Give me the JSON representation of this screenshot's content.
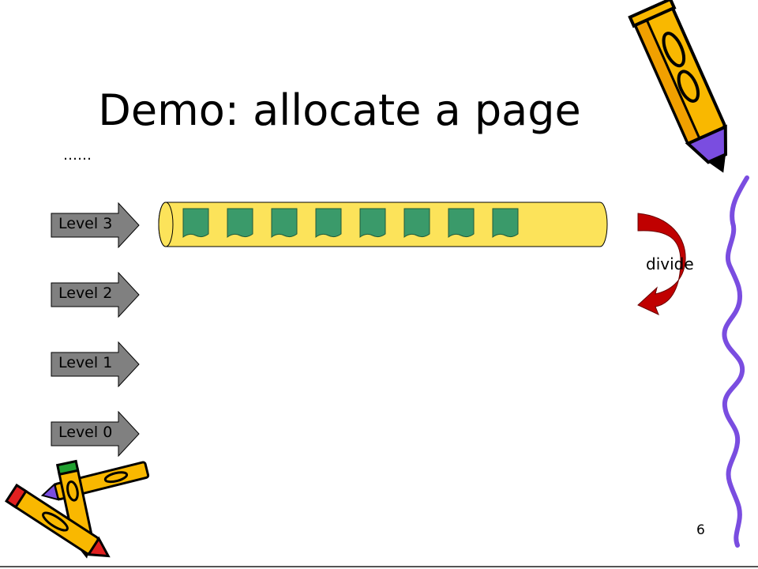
{
  "slide": {
    "title": "Demo: allocate a page",
    "ellipsis": "……",
    "levels": [
      "Level 3",
      "Level 2",
      "Level 1",
      "Level 0"
    ],
    "pages_in_level3": 8,
    "divide_label": "divide",
    "page_number": "6"
  },
  "colors": {
    "tube": "#fce35a",
    "page_block": "#3a9a6a",
    "level_arrow": "#808080",
    "divide_arrow": "#c00000",
    "pencil_body": "#f9b800",
    "squiggle": "#7a4de0"
  },
  "icons": [
    "pencil-clipart-icon",
    "crossed-pencils-clipart-icon",
    "squiggle-decoration"
  ]
}
